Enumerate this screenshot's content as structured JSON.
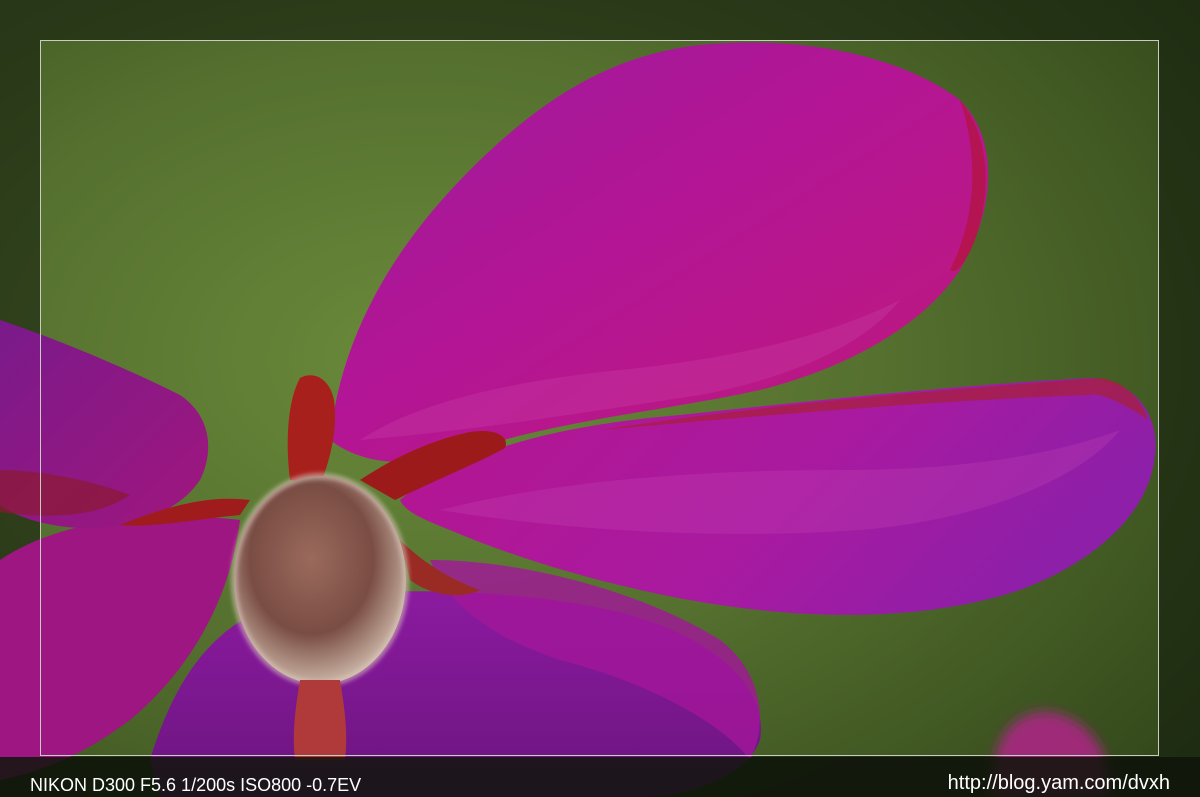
{
  "caption": {
    "camera_info": "NIKON D300 F5.6 1/200s ISO800 -0.7EV",
    "url": "http://blog.yam.com/dvxh"
  },
  "colors": {
    "background_green": "#55702f",
    "petal_magenta": "#b0178f",
    "petal_violet": "#8a1fa6",
    "bud_hair": "#c9b3a4",
    "sepal_red": "#a8201c",
    "frame_border": "#c9ccc2",
    "outer_border": "#10140c",
    "caption_text": "#ffffff"
  }
}
